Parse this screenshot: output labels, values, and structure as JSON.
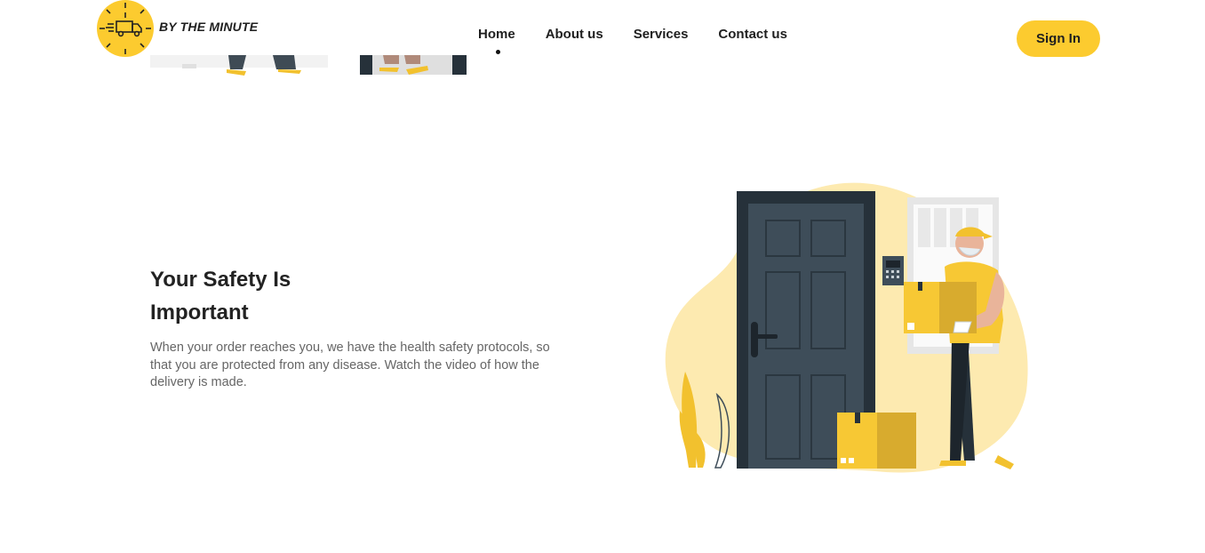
{
  "brand": {
    "name": "BY THE MINUTE",
    "accent": "#fccb2f"
  },
  "nav": {
    "items": [
      {
        "label": "Home"
      },
      {
        "label": "About us"
      },
      {
        "label": "Services"
      },
      {
        "label": "Contact us"
      }
    ]
  },
  "header": {
    "signin_label": "Sign In"
  },
  "section": {
    "title": "Your Safety Is Important",
    "description": "When your order reaches you, we have the health safety protocols, so that you are protected from any disease. Watch the video of how the delivery is made.",
    "illustration": "delivery-person-at-door"
  }
}
